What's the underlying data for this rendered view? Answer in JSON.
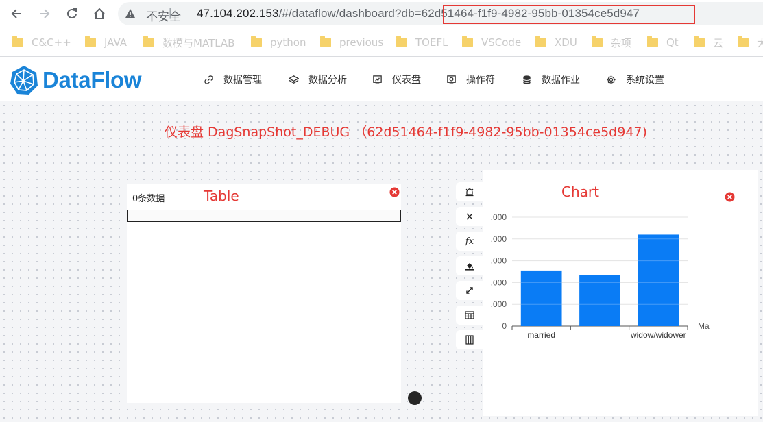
{
  "browser": {
    "insecure_label": "不安全",
    "separator": "|",
    "url_host": "47.104.202.153",
    "url_path": "/#/dataflow/dashboard?db=",
    "url_db_id": "62d51464-f1f9-4982-95bb-01354ce5d947",
    "bookmarks": [
      "C&C++",
      "JAVA",
      "数模与MATLAB",
      "python",
      "previous",
      "TOEFL",
      "VSCode",
      "XDU",
      "杂项",
      "Qt",
      "云",
      "大"
    ]
  },
  "app": {
    "logo_text": "DataFlow",
    "menu": [
      {
        "label": "数据管理",
        "icon": "link-icon"
      },
      {
        "label": "数据分析",
        "icon": "layers-icon"
      },
      {
        "label": "仪表盘",
        "icon": "dashboard-icon"
      },
      {
        "label": "操作符",
        "icon": "operator-icon"
      },
      {
        "label": "数据作业",
        "icon": "database-icon"
      },
      {
        "label": "系统设置",
        "icon": "gear-icon"
      }
    ]
  },
  "dashboard": {
    "title": "仪表盘 DagSnapShot_DEBUG （62d51464-f1f9-4982-95bb-01354ce5d947)"
  },
  "table_widget": {
    "count_text": "0条数据",
    "name": "Table"
  },
  "tools": [
    {
      "icon": "alarm-icon"
    },
    {
      "icon": "close-icon"
    },
    {
      "icon": "fx-icon",
      "text": "fx"
    },
    {
      "icon": "fill-icon"
    },
    {
      "icon": "expand-icon"
    },
    {
      "icon": "table-icon"
    },
    {
      "icon": "columns-icon"
    }
  ],
  "chart_widget": {
    "name": "Chart"
  },
  "chart_data": {
    "type": "bar",
    "categories": [
      "married",
      "",
      "widow/widower"
    ],
    "values": [
      2550,
      2330,
      4200
    ],
    "ytick_labels": [
      ",000",
      ",000",
      ",000",
      ",000",
      ",000",
      "0"
    ],
    "ylim": [
      0,
      5000
    ],
    "xlabel_partial": "Ma",
    "grid": true,
    "color": "#0a7cf5"
  }
}
